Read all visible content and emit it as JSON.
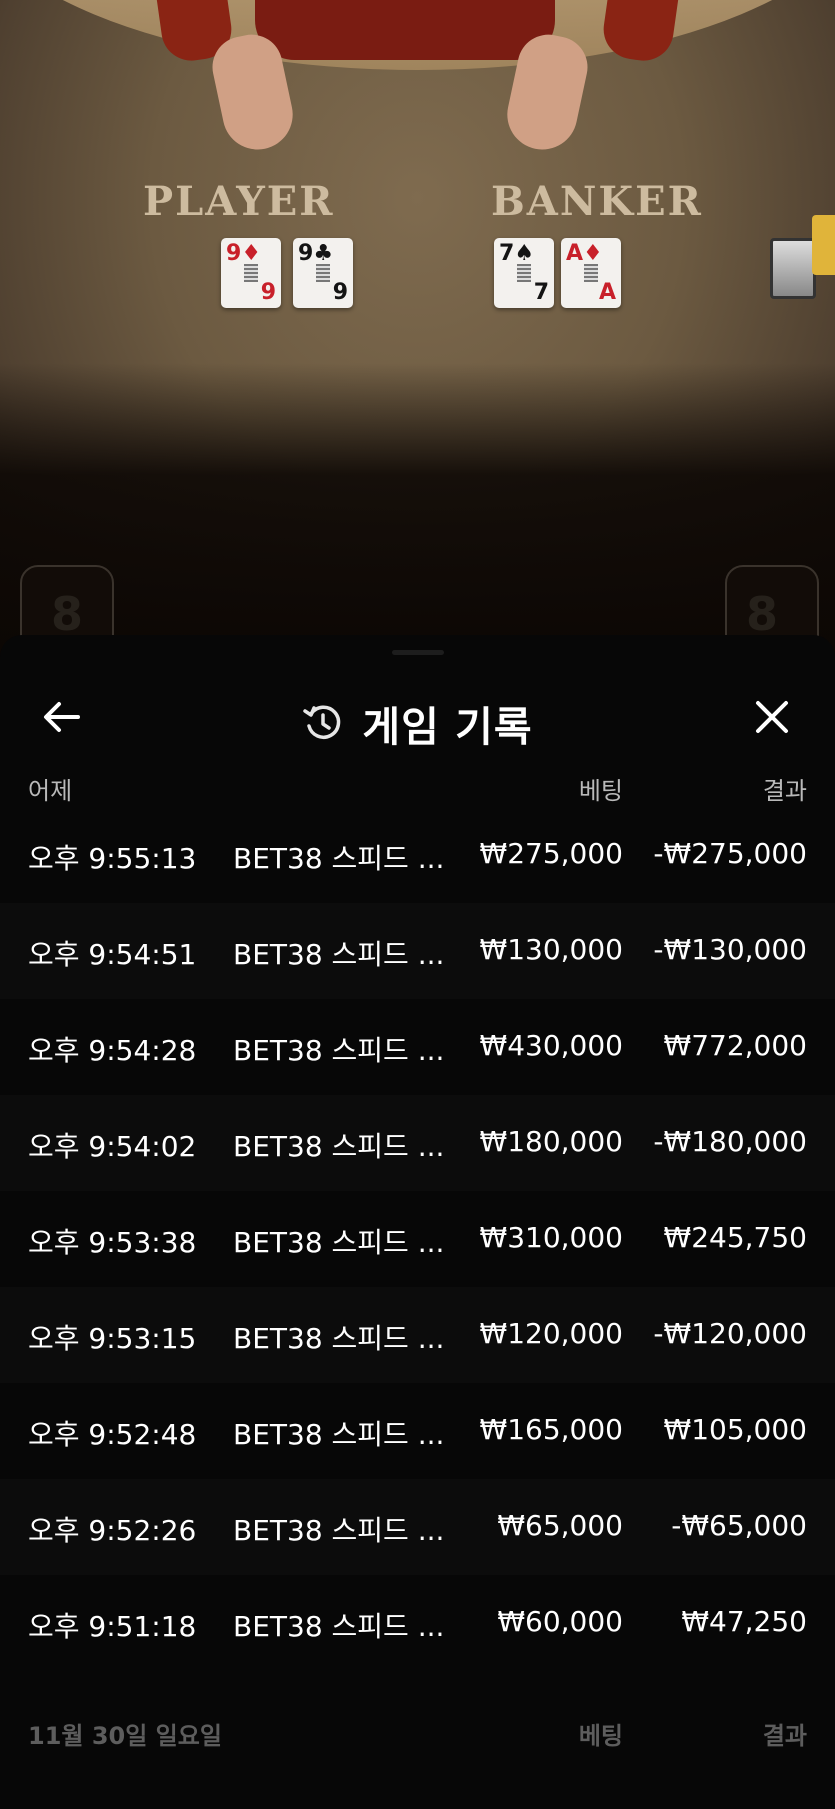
{
  "video": {
    "player_label": "PLAYER",
    "banker_label": "BANKER",
    "player_cards": [
      {
        "rank": "9",
        "suit": "♦",
        "color": "red"
      },
      {
        "rank": "9",
        "suit": "♣",
        "color": "black"
      }
    ],
    "banker_cards": [
      {
        "rank": "7",
        "suit": "♠",
        "color": "black"
      },
      {
        "rank": "A",
        "suit": "♦",
        "color": "red"
      }
    ],
    "seat_left": "8",
    "seat_right": "8"
  },
  "header": {
    "title": "게임 기록",
    "back_icon": "arrow-left-icon",
    "history_icon": "history-icon",
    "close_icon": "close-icon"
  },
  "section_yesterday": {
    "date": "어제",
    "bet_header": "베팅",
    "result_header": "결과"
  },
  "rows": [
    {
      "time": "오후 9:55:13",
      "game": "BET38 스피드 ...",
      "bet": "₩275,000",
      "result": "-₩275,000"
    },
    {
      "time": "오후 9:54:51",
      "game": "BET38 스피드 ...",
      "bet": "₩130,000",
      "result": "-₩130,000"
    },
    {
      "time": "오후 9:54:28",
      "game": "BET38 스피드 ...",
      "bet": "₩430,000",
      "result": "₩772,000"
    },
    {
      "time": "오후 9:54:02",
      "game": "BET38 스피드 ...",
      "bet": "₩180,000",
      "result": "-₩180,000"
    },
    {
      "time": "오후 9:53:38",
      "game": "BET38 스피드 ...",
      "bet": "₩310,000",
      "result": "₩245,750"
    },
    {
      "time": "오후 9:53:15",
      "game": "BET38 스피드 ...",
      "bet": "₩120,000",
      "result": "-₩120,000"
    },
    {
      "time": "오후 9:52:48",
      "game": "BET38 스피드 ...",
      "bet": "₩165,000",
      "result": "₩105,000"
    },
    {
      "time": "오후 9:52:26",
      "game": "BET38 스피드 ...",
      "bet": "₩65,000",
      "result": "-₩65,000"
    },
    {
      "time": "오후 9:51:18",
      "game": "BET38 스피드 ...",
      "bet": "₩60,000",
      "result": "₩47,250"
    }
  ],
  "section_nov30": {
    "date": "11월 30일 일요일",
    "bet_header": "베팅",
    "result_header": "결과"
  },
  "colors": {
    "sheet_bg": "#070707",
    "text_primary": "#ffffff",
    "text_secondary": "#b9b9b9",
    "text_dim": "#5d5d5d"
  }
}
